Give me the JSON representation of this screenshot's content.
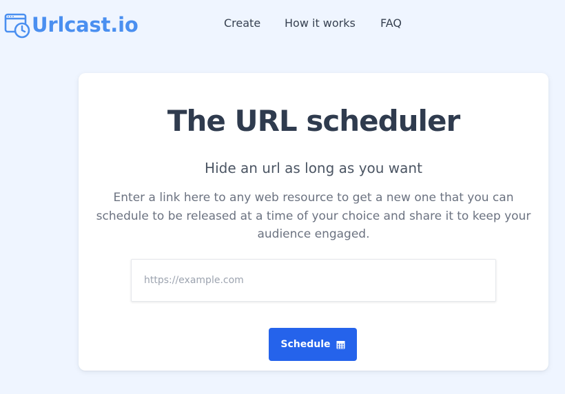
{
  "header": {
    "logo_text": "Urlcast.io",
    "logo_icon": "calendar-clock-icon",
    "nav": [
      {
        "label": "Create"
      },
      {
        "label": "How it works"
      },
      {
        "label": "FAQ"
      }
    ]
  },
  "hero": {
    "title": "The URL scheduler",
    "subtitle": "Hide an url as long as you want",
    "description": "Enter a link here to any web resource to get a new one that you can schedule to be released at a time of your choice and share it to keep your audience engaged."
  },
  "form": {
    "url_placeholder": "https://example.com",
    "url_value": "",
    "schedule_label": "Schedule",
    "schedule_icon": "calendar-icon"
  },
  "colors": {
    "background": "#eff5ff",
    "brand": "#4a8ff0",
    "primary_button": "#2563eb",
    "heading": "#2f3b4e"
  }
}
